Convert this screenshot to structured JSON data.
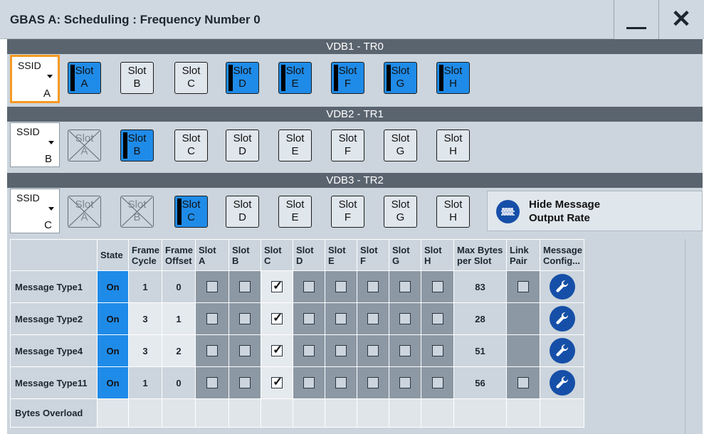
{
  "window": {
    "title": "GBAS A: Scheduling : Frequency Number 0",
    "minimize_icon": "minimize-icon",
    "close_icon": "close-icon",
    "close_glyph": "✕"
  },
  "vdb": [
    {
      "header": "VDB1 - TR0",
      "ssid_label": "SSID",
      "ssid_value": "A",
      "slots": [
        {
          "word": "Slot",
          "letter": "A",
          "state": "on"
        },
        {
          "word": "Slot",
          "letter": "B",
          "state": "off"
        },
        {
          "word": "Slot",
          "letter": "C",
          "state": "off"
        },
        {
          "word": "Slot",
          "letter": "D",
          "state": "on"
        },
        {
          "word": "Slot",
          "letter": "E",
          "state": "on"
        },
        {
          "word": "Slot",
          "letter": "F",
          "state": "on"
        },
        {
          "word": "Slot",
          "letter": "G",
          "state": "on"
        },
        {
          "word": "Slot",
          "letter": "H",
          "state": "on"
        }
      ]
    },
    {
      "header": "VDB2 - TR1",
      "ssid_label": "SSID",
      "ssid_value": "B",
      "slots": [
        {
          "word": "Slot",
          "letter": "A",
          "state": "disabled"
        },
        {
          "word": "Slot",
          "letter": "B",
          "state": "on"
        },
        {
          "word": "Slot",
          "letter": "C",
          "state": "off"
        },
        {
          "word": "Slot",
          "letter": "D",
          "state": "off"
        },
        {
          "word": "Slot",
          "letter": "E",
          "state": "off"
        },
        {
          "word": "Slot",
          "letter": "F",
          "state": "off"
        },
        {
          "word": "Slot",
          "letter": "G",
          "state": "off"
        },
        {
          "word": "Slot",
          "letter": "H",
          "state": "off"
        }
      ]
    },
    {
      "header": "VDB3 - TR2",
      "ssid_label": "SSID",
      "ssid_value": "C",
      "slots": [
        {
          "word": "Slot",
          "letter": "A",
          "state": "disabled"
        },
        {
          "word": "Slot",
          "letter": "B",
          "state": "disabled"
        },
        {
          "word": "Slot",
          "letter": "C",
          "state": "on"
        },
        {
          "word": "Slot",
          "letter": "D",
          "state": "off"
        },
        {
          "word": "Slot",
          "letter": "E",
          "state": "off"
        },
        {
          "word": "Slot",
          "letter": "F",
          "state": "off"
        },
        {
          "word": "Slot",
          "letter": "G",
          "state": "off"
        },
        {
          "word": "Slot",
          "letter": "H",
          "state": "off"
        }
      ]
    }
  ],
  "hide_button": {
    "line1": "Hide Message",
    "line2": "Output Rate",
    "icon": "output-rate-icon"
  },
  "table": {
    "headers": {
      "state": "State",
      "frame_cycle": [
        "Frame",
        "Cycle"
      ],
      "frame_offset": [
        "Frame",
        "Offset"
      ],
      "slots": [
        [
          "Slot",
          "A"
        ],
        [
          "Slot",
          "B"
        ],
        [
          "Slot",
          "C"
        ],
        [
          "Slot",
          "D"
        ],
        [
          "Slot",
          "E"
        ],
        [
          "Slot",
          "F"
        ],
        [
          "Slot",
          "G"
        ],
        [
          "Slot",
          "H"
        ]
      ],
      "max_bytes": [
        "Max Bytes",
        "per Slot"
      ],
      "link_pair": [
        "Link",
        "Pair"
      ],
      "message_config": [
        "Message",
        "Config..."
      ]
    },
    "rows": [
      {
        "label": "Message Type1",
        "state": "On",
        "frame_cycle": "1",
        "frame_offset": "0",
        "slots": [
          false,
          false,
          true,
          false,
          false,
          false,
          false,
          false
        ],
        "max_bytes": "83",
        "link_pair": "unchecked",
        "config_icon": "wrench-icon",
        "cycle_editable": false
      },
      {
        "label": "Message Type2",
        "state": "On",
        "frame_cycle": "3",
        "frame_offset": "1",
        "slots": [
          false,
          false,
          true,
          false,
          false,
          false,
          false,
          false
        ],
        "max_bytes": "28",
        "link_pair": "none",
        "config_icon": "wrench-icon",
        "cycle_editable": true
      },
      {
        "label": "Message Type4",
        "state": "On",
        "frame_cycle": "3",
        "frame_offset": "2",
        "slots": [
          false,
          false,
          true,
          false,
          false,
          false,
          false,
          false
        ],
        "max_bytes": "51",
        "link_pair": "none",
        "config_icon": "wrench-icon",
        "cycle_editable": true
      },
      {
        "label": "Message Type11",
        "state": "On",
        "frame_cycle": "1",
        "frame_offset": "0",
        "slots": [
          false,
          false,
          true,
          false,
          false,
          false,
          false,
          false
        ],
        "max_bytes": "56",
        "link_pair": "unchecked",
        "config_icon": "wrench-icon",
        "cycle_editable": false
      }
    ],
    "overload_label": "Bytes Overload",
    "check_glyph": "✓"
  },
  "colors": {
    "accent_blue": "#1f8be8",
    "icon_blue": "#164fa8",
    "focus_orange": "#f59a23",
    "header_dark": "#5a646f",
    "panel": "#ccd5dd"
  }
}
